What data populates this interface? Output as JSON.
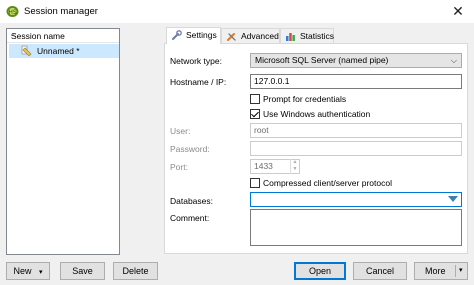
{
  "window": {
    "title": "Session manager",
    "close_glyph": "✕"
  },
  "sessions": {
    "column_header": "Session name",
    "sort_glyph": "^",
    "items": [
      {
        "label": "Unnamed *"
      }
    ]
  },
  "left_buttons": {
    "new_label": "New",
    "save_label": "Save",
    "delete_label": "Delete"
  },
  "tabs": [
    {
      "label": "Settings",
      "icon": "wrench-icon",
      "active": true
    },
    {
      "label": "Advanced",
      "icon": "tools-icon",
      "active": false
    },
    {
      "label": "Statistics",
      "icon": "bar-chart-icon",
      "active": false
    }
  ],
  "settings": {
    "network_type": {
      "label": "Network type:",
      "value": "Microsoft SQL Server (named pipe)"
    },
    "hostname": {
      "label": "Hostname / IP:",
      "value": "127.0.0.1"
    },
    "prompt_credentials": {
      "label": "Prompt for credentials",
      "checked": false
    },
    "windows_auth": {
      "label": "Use Windows authentication",
      "checked": true
    },
    "user": {
      "label": "User:",
      "value": "root"
    },
    "password": {
      "label": "Password:",
      "value": ""
    },
    "port": {
      "label": "Port:",
      "value": "1433"
    },
    "compressed": {
      "label": "Compressed client/server protocol",
      "checked": false
    },
    "databases": {
      "label": "Databases:",
      "value": ""
    },
    "comment": {
      "label": "Comment:",
      "value": ""
    }
  },
  "bottom_buttons": {
    "open_label": "Open",
    "cancel_label": "Cancel",
    "more_label": "More"
  },
  "colors": {
    "accent": "#0078d7",
    "selection": "#cce8ff",
    "combo_arrow": "#3c7fb1"
  }
}
